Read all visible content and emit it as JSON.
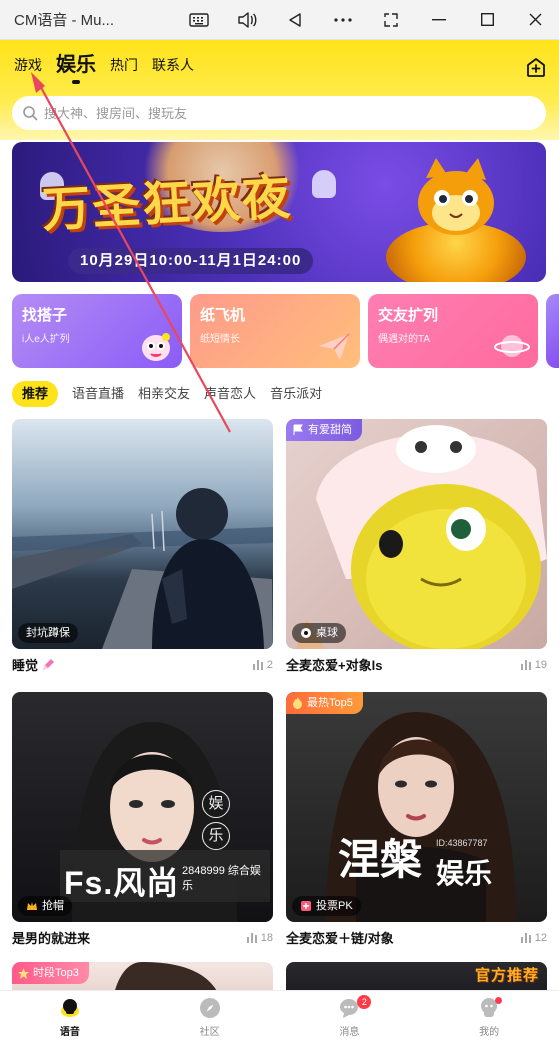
{
  "window": {
    "title": "CM语音 - Mu..."
  },
  "header": {
    "tabs": [
      {
        "label": "游戏"
      },
      {
        "label": "娱乐"
      },
      {
        "label": "热门"
      },
      {
        "label": "联系人"
      }
    ]
  },
  "search": {
    "placeholder": "搜大神、搜房间、搜玩友"
  },
  "banner": {
    "headline": "万圣狂欢夜",
    "date": "10月29日10:00-11月1日24:00"
  },
  "categories": [
    {
      "title": "找搭子",
      "subtitle": "i人e人扩列",
      "color_from": "#b48cf5",
      "color_to": "#8b5cf6"
    },
    {
      "title": "纸飞机",
      "subtitle": "纸短情长",
      "color_from": "#ff9a8b",
      "color_to": "#ffb36b"
    },
    {
      "title": "交友扩列",
      "subtitle": "偶遇对的TA",
      "color_from": "#ff7eb3",
      "color_to": "#ff6b9d"
    }
  ],
  "subtabs": [
    {
      "label": "推荐"
    },
    {
      "label": "语音直播"
    },
    {
      "label": "相亲交友"
    },
    {
      "label": "声音恋人"
    },
    {
      "label": "音乐派对"
    }
  ],
  "rooms": [
    {
      "name": "睡觉",
      "tag": "封坑蹲保",
      "ribbon": "",
      "count": "2"
    },
    {
      "name": "全麦恋爱+对象ls",
      "tag": "桌球",
      "ribbon": "有爱甜简",
      "count": "19"
    },
    {
      "name": "是男的就进来",
      "tag": "抢帽",
      "ribbon": "",
      "count": "18"
    },
    {
      "name": "全麦恋爱＋链/对象",
      "tag": "投票PK",
      "ribbon": "最热Top5",
      "count": "12"
    },
    {
      "name": "",
      "tag": "",
      "ribbon": "时段Top3",
      "count": ""
    },
    {
      "name": "",
      "tag": "",
      "ribbon": "官方推荐",
      "count": ""
    }
  ],
  "covers": {
    "room1_overlay": "",
    "room3_overlay_1": "娱",
    "room3_overlay_2": "乐",
    "room3_brand": "Fs.风尚",
    "room3_brand_sub": "2848999 综合娱乐",
    "room4_overlay": "涅槃",
    "room4_overlay_2": "娱乐",
    "room4_id": "ID:43867787"
  },
  "bottom_nav": [
    {
      "label": "语音",
      "badge": ""
    },
    {
      "label": "社区",
      "badge": ""
    },
    {
      "label": "消息",
      "badge": "2"
    },
    {
      "label": "我的",
      "badge": ""
    }
  ],
  "colors": {
    "accent": "#ffe31a",
    "badge": "#ff3b4a",
    "arrow": "#e8475f"
  }
}
